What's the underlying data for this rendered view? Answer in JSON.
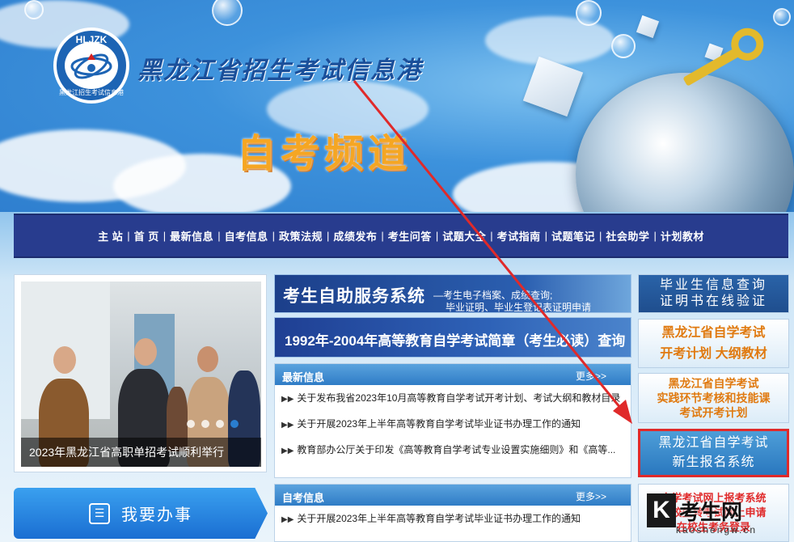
{
  "header": {
    "logo_text": "HLJZK",
    "logo_sub": "黑龙江招生考试信息港",
    "site_title": "黑龙江省招生考试信息港",
    "channel_title": "自考频道"
  },
  "nav": {
    "items": [
      "主 站",
      "首 页",
      "最新信息",
      "自考信息",
      "政策法规",
      "成绩发布",
      "考生问答",
      "试题大全",
      "考试指南",
      "试题笔记",
      "社会助学",
      "计划教材"
    ]
  },
  "slideshow": {
    "caption": "2023年黑龙江省高职单招考试顺利举行",
    "active_dot": 3
  },
  "action_button": {
    "label": "我要办事"
  },
  "self_service": {
    "title": "考生自助服务系统",
    "sub1": "—考生电子档案、成绩查询;",
    "sub2": "毕业证明、毕业生登记表证明申请"
  },
  "query_banner": {
    "label": "1992年-2004年高等教育自学考试简章（考生必读）查询"
  },
  "latest_news": {
    "title": "最新信息",
    "more": "更多>>",
    "items": [
      "关于发布我省2023年10月高等教育自学考试开考计划、考试大纲和教材目录",
      "关于开展2023年上半年高等教育自学考试毕业证书办理工作的通知",
      "教育部办公厅关于印发《高等教育自学考试专业设置实施细则》和《高等..."
    ]
  },
  "zk_news": {
    "title": "自考信息",
    "more": "更多>>",
    "items": [
      "关于开展2023年上半年高等教育自学考试毕业证书办理工作的通知"
    ]
  },
  "side_buttons": {
    "b1": [
      "毕业生信息查询",
      "证明书在线验证"
    ],
    "b2": [
      "黑龙江省自学考试",
      "开考计划  大纲教材"
    ],
    "b3": [
      "黑龙江省自学考试",
      "实践环节考核和技能课",
      "考试开考计划"
    ],
    "b4": [
      "黑龙江省自学考试",
      "新生报名系统"
    ],
    "b5": [
      "自学考试网上报考系统",
      "在校生转考试网上申请",
      "在校生考务登录"
    ]
  },
  "watermark": {
    "k": "K",
    "text": "考生网",
    "url": "kaoshengw.cn"
  },
  "colors": {
    "nav_bg": "#283c8e",
    "accent_orange": "#e07a10",
    "highlight_red": "#e02a2a"
  }
}
